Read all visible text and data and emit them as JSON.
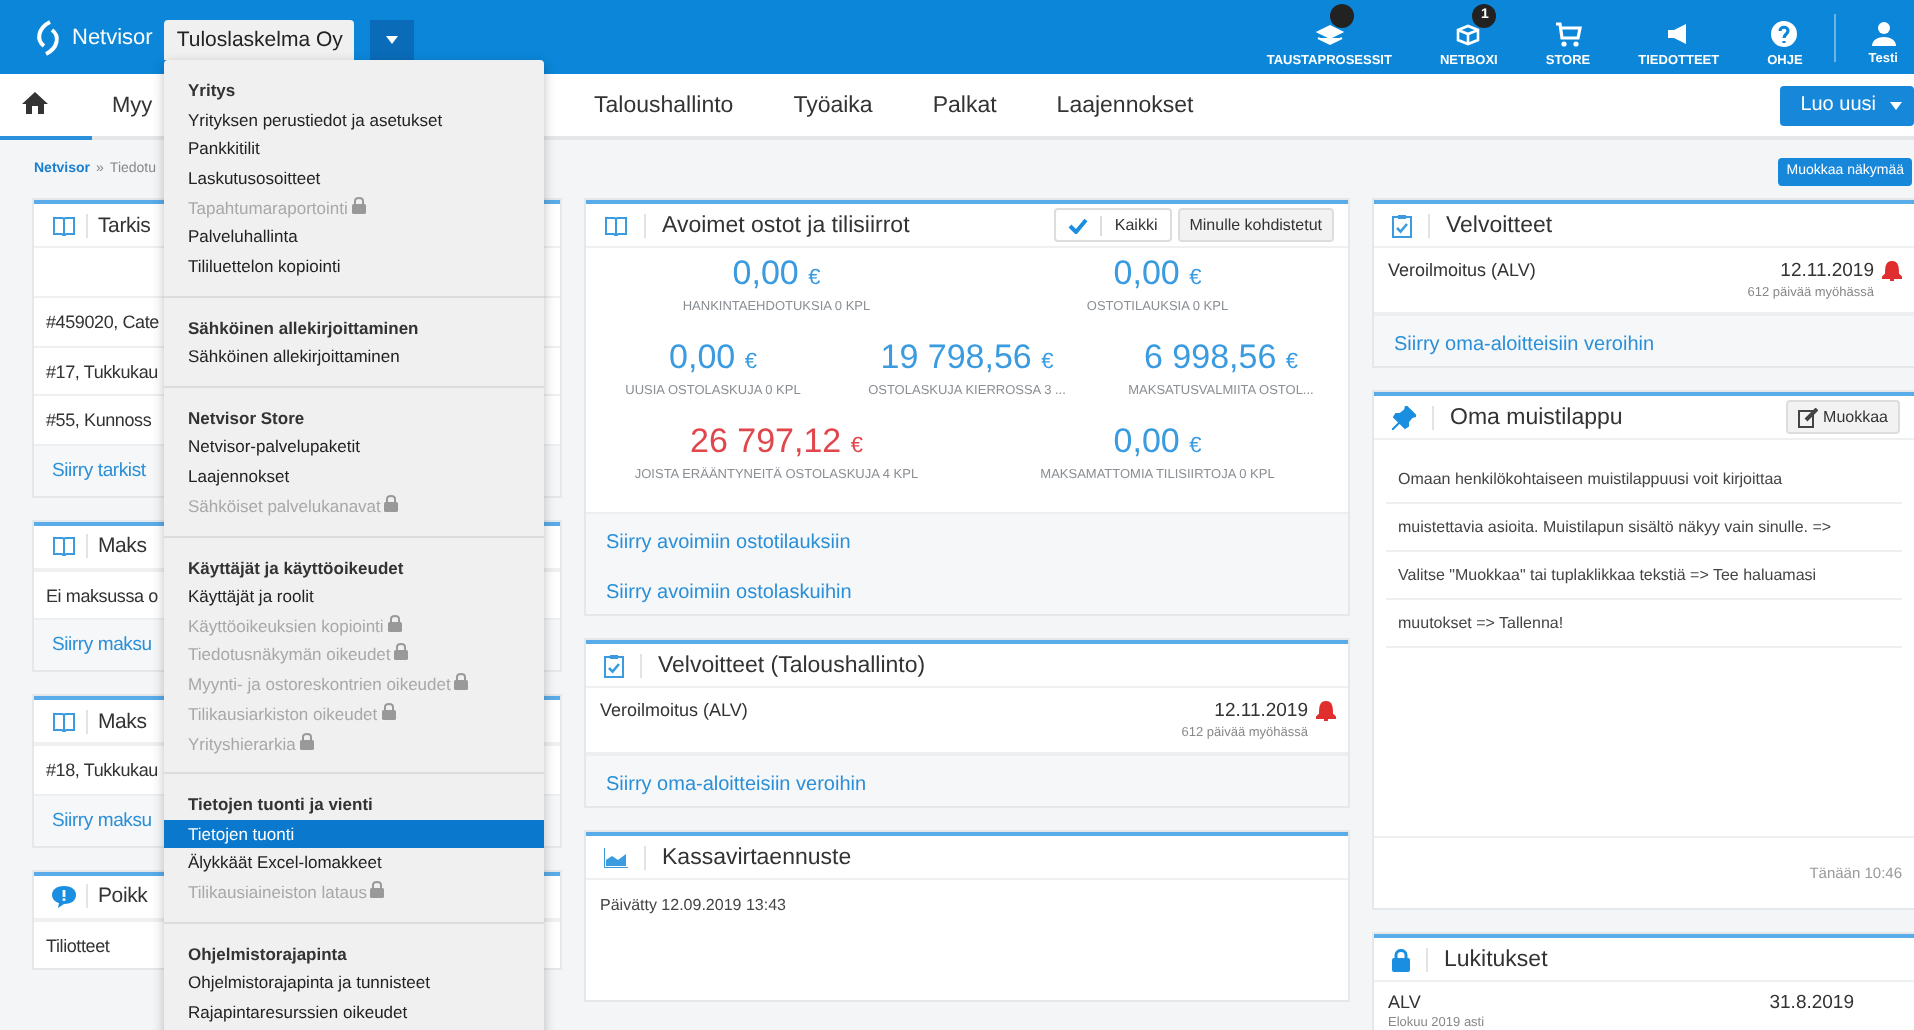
{
  "topbar": {
    "logo": "Netvisor",
    "company": "Tuloslaskelma Oy",
    "tools": [
      {
        "label": "TAUSTAPROSESSIT",
        "kind": "layers",
        "dot": true
      },
      {
        "label": "NETBOXI",
        "kind": "box",
        "badge": "1"
      },
      {
        "label": "STORE",
        "kind": "cart"
      },
      {
        "label": "TIEDOTTEET",
        "kind": "megaphone"
      },
      {
        "label": "OHJE",
        "kind": "help"
      }
    ],
    "user": "Testi"
  },
  "nav": {
    "items": [
      {
        "kind": "home",
        "selected": true
      },
      {
        "kind": "text",
        "label": "Myy",
        "selected": false
      },
      {
        "kind": "text",
        "label": "Taloushallinto",
        "selected": false
      },
      {
        "kind": "text",
        "label": "Työaika",
        "selected": false
      },
      {
        "kind": "text",
        "label": "Palkat",
        "selected": false
      },
      {
        "kind": "text",
        "label": "Laajennokset",
        "selected": false
      }
    ],
    "create_button": "Luo uusi"
  },
  "breadcrumb": {
    "link": "Netvisor",
    "separator": "»",
    "current": "Tiedotu"
  },
  "edit_view_button": "Muokkaa näkymää",
  "left_cards": [
    {
      "kind": "list",
      "title": "Tarkis",
      "rows": [
        "#459020, Cate",
        "#17, Tukkukau",
        "#55, Kunnoss"
      ],
      "link": "Siirry tarkist"
    },
    {
      "kind": "list",
      "title": "Maks",
      "rows": [
        "Ei maksussa o"
      ],
      "link": "Siirry maksu"
    },
    {
      "kind": "list",
      "title": "Maks",
      "rows": [
        "#18, Tukkukau"
      ],
      "link": "Siirry maksu"
    },
    {
      "kind": "alert",
      "title": "Poikk",
      "rows": [
        "Tiliotteet"
      ]
    }
  ],
  "middle_cards": [
    {
      "kind": "stats",
      "title": "Avoimet ostot ja tilisiirrot",
      "toggle": {
        "label": "Kaikki",
        "checked": true
      },
      "button": "Minulle kohdistetut",
      "stat_rows": [
        [
          {
            "value": "0,00",
            "unit": "€",
            "label": "HANKINTAEHDOTUKSIA 0 KPL",
            "overdue": false
          },
          {
            "value": "0,00",
            "unit": "€",
            "label": "OSTOTILAUKSIA 0 KPL",
            "overdue": false
          }
        ],
        [
          {
            "value": "0,00",
            "unit": "€",
            "label": "UUSIA OSTOLASKUJA 0 KPL",
            "overdue": false
          },
          {
            "value": "19 798,56",
            "unit": "€",
            "label": "OSTOLASKUJA KIERROSSA 3 ...",
            "overdue": false
          },
          {
            "value": "6 998,56",
            "unit": "€",
            "label": "MAKSATUSVALMIITA OSTOL...",
            "overdue": false
          }
        ],
        [
          {
            "value": "26 797,12",
            "unit": "€",
            "label": "JOISTA ERÄÄNTYNEITÄ OSTOLASKUJA 4 KPL",
            "overdue": true
          },
          {
            "value": "0,00",
            "unit": "€",
            "label": "MAKSAMATTOMIA TILISIIRTOJA 0 KPL",
            "overdue": false
          }
        ]
      ],
      "links": [
        "Siirry avoimiin ostotilauksiin",
        "Siirry avoimiin ostolaskuihin"
      ]
    },
    {
      "kind": "obligations",
      "title": "Velvoitteet (Taloushallinto)",
      "items": [
        {
          "name": "Veroilmoitus (ALV)",
          "date": "12.11.2019",
          "note": "612 päivää myöhässä",
          "alarm": true
        }
      ],
      "links": [
        "Siirry oma-aloitteisiin veroihin"
      ]
    },
    {
      "kind": "forecast",
      "title": "Kassavirtaennuste",
      "text": "Päivätty 12.09.2019 13:43"
    }
  ],
  "right_cards": [
    {
      "kind": "obligations",
      "title": "Velvoitteet",
      "items": [
        {
          "name": "Veroilmoitus (ALV)",
          "date": "12.11.2019",
          "note": "612 päivää myöhässä",
          "alarm": true
        }
      ],
      "links": [
        "Siirry oma-aloitteisiin veroihin"
      ]
    },
    {
      "kind": "note",
      "title": "Oma muistilappu",
      "button": "Muokkaa",
      "lines": [
        "Omaan henkilökohtaiseen muistilappuusi voit kirjoittaa",
        "muistettavia asioita. Muistilapun sisältö näkyy vain sinulle.  =>",
        "Valitse \"Muokkaa\" tai tuplaklikkaa tekstiä  => Tee haluamasi",
        "muutokset  => Tallenna!"
      ],
      "footer": "Tänään 10:46"
    },
    {
      "kind": "locks",
      "title": "Lukitukset",
      "items": [
        {
          "name": "ALV",
          "date": "31.8.2019",
          "note": "Elokuu 2019 asti"
        }
      ]
    }
  ],
  "menu": {
    "sections": [
      {
        "title": "Yritys",
        "items": [
          {
            "label": "Yrityksen perustiedot ja asetukset",
            "locked": false,
            "selected": false
          },
          {
            "label": "Pankkitilit",
            "locked": false,
            "selected": false
          },
          {
            "label": "Laskutusosoitteet",
            "locked": false,
            "selected": false
          },
          {
            "label": "Tapahtumaraportointi",
            "locked": true,
            "selected": false
          },
          {
            "label": "Palveluhallinta",
            "locked": false,
            "selected": false
          },
          {
            "label": "Tililuettelon kopiointi",
            "locked": false,
            "selected": false
          }
        ]
      },
      {
        "title": "Sähköinen allekirjoittaminen",
        "items": [
          {
            "label": "Sähköinen allekirjoittaminen",
            "locked": false,
            "selected": false
          }
        ]
      },
      {
        "title": "Netvisor Store",
        "items": [
          {
            "label": "Netvisor-palvelupaketit",
            "locked": false,
            "selected": false
          },
          {
            "label": "Laajennokset",
            "locked": false,
            "selected": false
          },
          {
            "label": "Sähköiset palvelukanavat",
            "locked": true,
            "selected": false
          }
        ]
      },
      {
        "title": "Käyttäjät ja käyttöoikeudet",
        "items": [
          {
            "label": "Käyttäjät ja roolit",
            "locked": false,
            "selected": false
          },
          {
            "label": "Käyttöoikeuksien kopiointi",
            "locked": true,
            "selected": false
          },
          {
            "label": "Tiedotusnäkymän oikeudet",
            "locked": true,
            "selected": false
          },
          {
            "label": "Myynti- ja ostoreskontrien oikeudet",
            "locked": true,
            "selected": false
          },
          {
            "label": "Tilikausiarkiston oikeudet",
            "locked": true,
            "selected": false
          },
          {
            "label": "Yrityshierarkia",
            "locked": true,
            "selected": false
          }
        ]
      },
      {
        "title": "Tietojen tuonti ja vienti",
        "items": [
          {
            "label": "Tietojen tuonti",
            "locked": false,
            "selected": true
          },
          {
            "label": "Älykkäät Excel-lomakkeet",
            "locked": false,
            "selected": false
          },
          {
            "label": "Tilikausiaineiston lataus",
            "locked": true,
            "selected": false
          }
        ]
      },
      {
        "title": "Ohjelmistorajapinta",
        "items": [
          {
            "label": "Ohjelmistorajapinta ja tunnisteet",
            "locked": false,
            "selected": false
          },
          {
            "label": "Rajapintaresurssien oikeudet",
            "locked": false,
            "selected": false
          }
        ]
      }
    ]
  }
}
